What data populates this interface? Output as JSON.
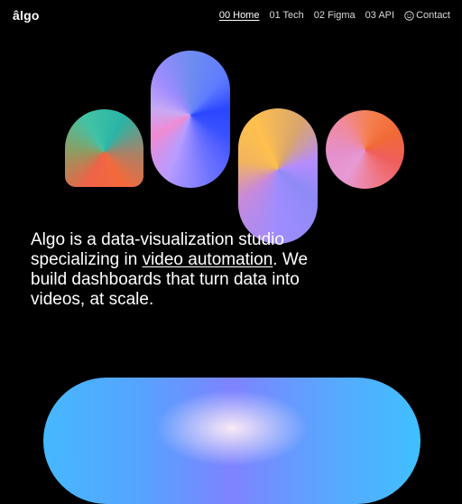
{
  "logo": "âlgo",
  "nav": {
    "items": [
      {
        "label": "00 Home",
        "active": true
      },
      {
        "label": "01 Tech"
      },
      {
        "label": "02 Figma"
      },
      {
        "label": "03 API"
      }
    ],
    "contact_label": "Contact",
    "contact_icon": "smile-icon"
  },
  "headline": {
    "part1": "Algo is a data-visualization studio specializing in ",
    "link": "video automation",
    "part2": ". We build dashboards that turn data into videos, at scale."
  },
  "colors": {
    "background": "#000000",
    "text": "#ffffff"
  }
}
